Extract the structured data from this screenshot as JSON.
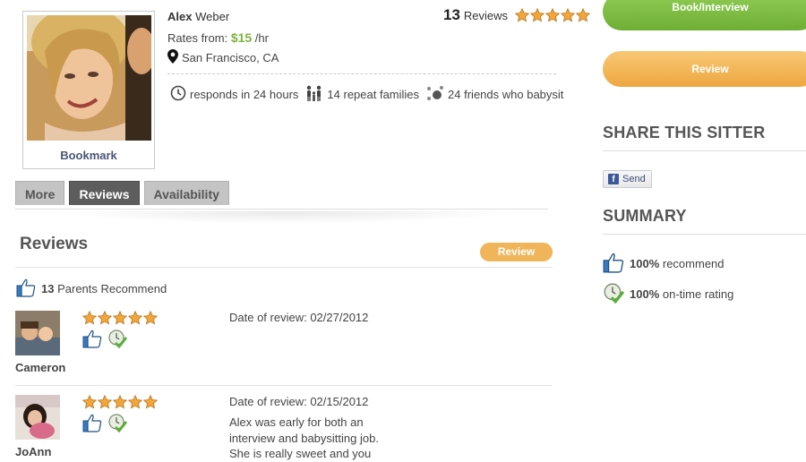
{
  "profile": {
    "first_name": "Alex",
    "last_name": "Weber",
    "rates_label": "Rates from:",
    "rate": "$15",
    "rate_unit": "/hr",
    "location": "San Francisco, CA",
    "bookmark_label": "Bookmark",
    "review_count": "13",
    "reviews_label": "Reviews",
    "rating_stars": 5
  },
  "stats": {
    "responds": "responds in 24 hours",
    "repeat_families": "14 repeat families",
    "friends": "24 friends who babysit"
  },
  "tabs": [
    {
      "label": "More",
      "active": false
    },
    {
      "label": "Reviews",
      "active": true
    },
    {
      "label": "Availability",
      "active": false
    }
  ],
  "reviews_section": {
    "title": "Reviews",
    "review_button": "Review",
    "recommend_count": "13",
    "recommend_label": "Parents Recommend"
  },
  "reviews": [
    {
      "name": "Cameron",
      "stars": 5,
      "date": "Date of review: 02/27/2012",
      "text": ""
    },
    {
      "name": "JoAnn",
      "stars": 5,
      "date": "Date of review: 02/15/2012",
      "text": "Alex was early for both an interview and babysitting job. She is really sweet and you"
    }
  ],
  "sidebar": {
    "book_button": "Book/Interview",
    "review_button": "Review",
    "share_heading": "SHARE THIS SITTER",
    "send_label": "Send",
    "summary_heading": "SUMMARY",
    "recommend_pct": "100%",
    "recommend_label": "recommend",
    "ontime_pct": "100%",
    "ontime_label": "on-time rating"
  },
  "colors": {
    "accent_green": "#7cb342",
    "button_green": "#7fbd45",
    "button_orange": "#f2b54f",
    "star": "#f0a030",
    "active_tab": "#5d5d5d"
  }
}
